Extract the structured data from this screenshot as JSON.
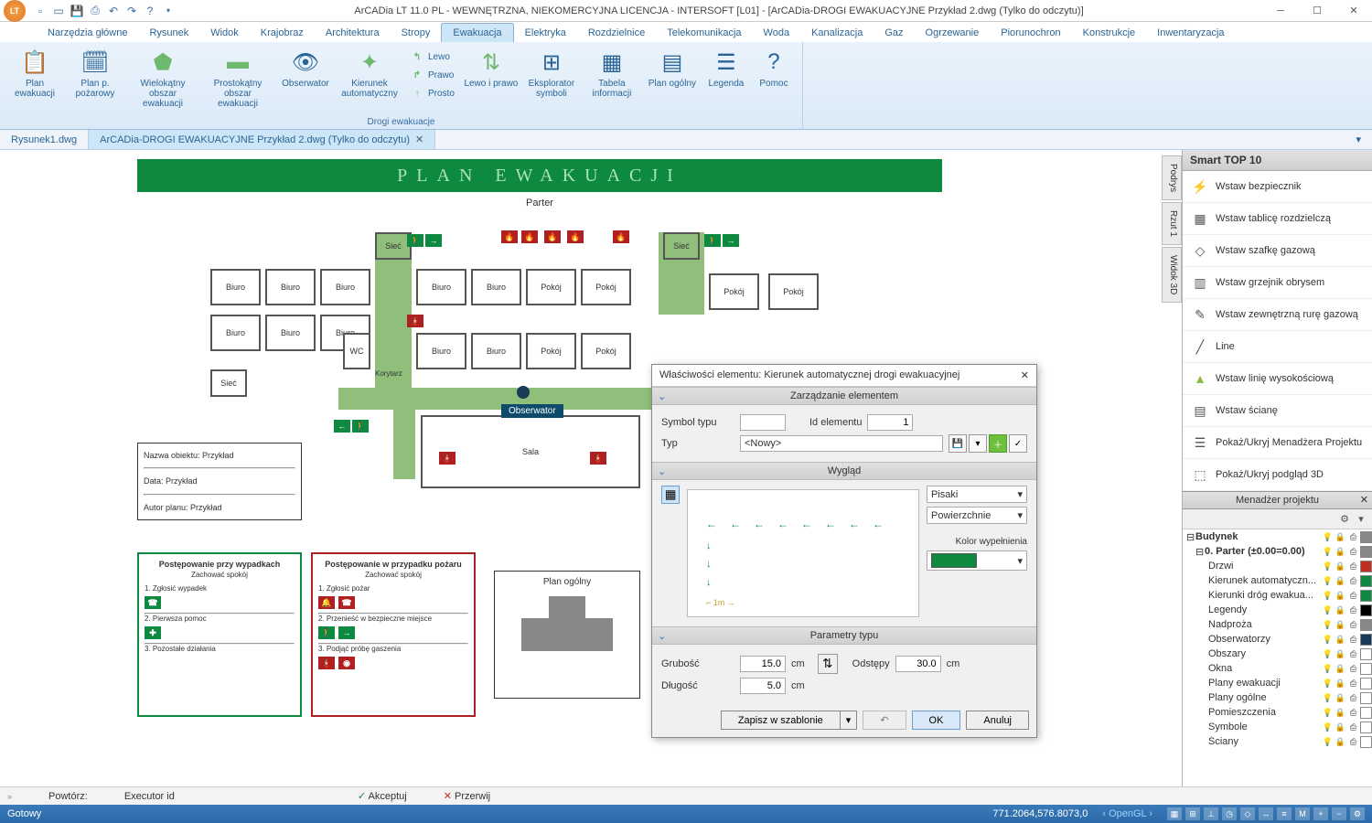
{
  "app": {
    "title": "ArCADia LT 11.0 PL - WEWNĘTRZNA, NIEKOMERCYJNA LICENCJA - INTERSOFT [L01] - [ArCADia-DROGI EWAKUACYJNE Przykład 2.dwg (Tylko do odczytu)]"
  },
  "menubar": {
    "tabs": [
      "Narzędzia główne",
      "Rysunek",
      "Widok",
      "Krajobraz",
      "Architektura",
      "Stropy",
      "Ewakuacja",
      "Elektryka",
      "Rozdzielnice",
      "Telekomunikacja",
      "Woda",
      "Kanalizacja",
      "Gaz",
      "Ogrzewanie",
      "Piorunochron",
      "Konstrukcje",
      "Inwentaryzacja"
    ],
    "active": 6
  },
  "ribbon": {
    "group_label": "Drogi ewakuacje",
    "btns": {
      "plan_ewak": "Plan ewakuacji",
      "plan_ppoz": "Plan p. pożarowy",
      "wielokat": "Wielokątny obszar ewakuacji",
      "prostokat": "Prostokątny obszar ewakuacji",
      "obserwator": "Obserwator",
      "kierunek": "Kierunek automatyczny",
      "lewo": "Lewo",
      "prawo": "Prawo",
      "prosto": "Prosto",
      "lewoiprawo": "Lewo i prawo",
      "eksplorator": "Eksplorator symboli",
      "tabela": "Tabela informacji",
      "plan_ogolny": "Plan ogólny",
      "legenda": "Legenda",
      "pomoc": "Pomoc"
    }
  },
  "doctabs": {
    "tab1": "Rysunek1.dwg",
    "tab2": "ArCADia-DROGI EWAKUACYJNE Przykład 2.dwg (Tylko do odczytu)"
  },
  "smart_top10": {
    "title": "Smart TOP 10",
    "items": [
      "Wstaw bezpiecznik",
      "Wstaw tablicę rozdzielczą",
      "Wstaw szafkę gazową",
      "Wstaw grzejnik obrysem",
      "Wstaw zewnętrzną rurę gazową",
      "Line",
      "Wstaw linię wysokościową",
      "Wstaw ścianę",
      "Pokaż/Ukryj Menadżera Projektu",
      "Pokaż/Ukryj podgląd 3D"
    ]
  },
  "project_manager": {
    "title": "Menadżer projektu",
    "root": "Budynek",
    "level": "0. Parter (±0.00=0.00)",
    "items": [
      "Drzwi",
      "Kierunek automatyczn...",
      "Kierunki dróg ewakua...",
      "Legendy",
      "Nadproża",
      "Obserwatorzy",
      "Obszary",
      "Okna",
      "Plany ewakuacji",
      "Plany ogólne",
      "Pomieszczenia",
      "Symbole",
      "Ściany"
    ]
  },
  "sidetabs": [
    "Podrys",
    "Rzut 1",
    "Widok 3D"
  ],
  "plan": {
    "title": "PLAN  EWAKUACJI",
    "subtitle": "Parter",
    "rooms": {
      "biuro": "Biuro",
      "pokoj": "Pokój",
      "wc": "WC",
      "siec": "Sieć",
      "sala": "Sala",
      "korytarz": "Korytarz"
    },
    "observer": "Obserwator",
    "legend": {
      "l1": "Nazwa obiektu: Przykład",
      "l2": "Data: Przykład",
      "l3": "Autor planu: Przykład"
    },
    "box_green": {
      "title": "Postępowanie przy wypadkach",
      "sub": "Zachować spokój",
      "i1": "1. Zgłosić wypadek",
      "i2": "2. Pierwsza pomoc",
      "i3": "3. Pozostałe działania"
    },
    "box_red": {
      "title": "Postępowanie w przypadku pożaru",
      "sub": "Zachować spokój",
      "i1": "1. Zgłosić pożar",
      "i2": "2. Przenieść w bezpieczne miejsce",
      "i3": "3. Podjąć próbę gaszenia"
    },
    "plan_ogolny": "Plan ogólny"
  },
  "dialog": {
    "title": "Właściwości elementu: Kierunek automatycznej drogi ewakuacyjnej",
    "sect_mgmt": "Zarządzanie elementem",
    "symbol_typu": "Symbol typu",
    "id_elementu": "Id elementu",
    "id_value": "1",
    "typ": "Typ",
    "typ_value": "<Nowy>",
    "sect_wyglad": "Wygląd",
    "pisaki": "Pisaki",
    "powierzchnie": "Powierzchnie",
    "kolor_wypelnienia": "Kolor wypełnienia",
    "sect_params": "Parametry typu",
    "grubosc": "Grubość",
    "grubosc_val": "15.0",
    "dlugosc": "Długość",
    "dlugosc_val": "5.0",
    "odstepy": "Odstępy",
    "odstepy_val": "30.0",
    "unit": "cm",
    "axis_label": "1m",
    "save_template": "Zapisz w szablonie",
    "ok": "OK",
    "anuluj": "Anuluj"
  },
  "cmdbar": {
    "powtorz": "Powtórz:",
    "executor": "Executor id",
    "akceptuj": "Akceptuj",
    "przerwij": "Przerwij"
  },
  "statusbar": {
    "gotowy": "Gotowy",
    "coords": "771.2064,576.8073,0",
    "opengl": "OpenGL"
  }
}
